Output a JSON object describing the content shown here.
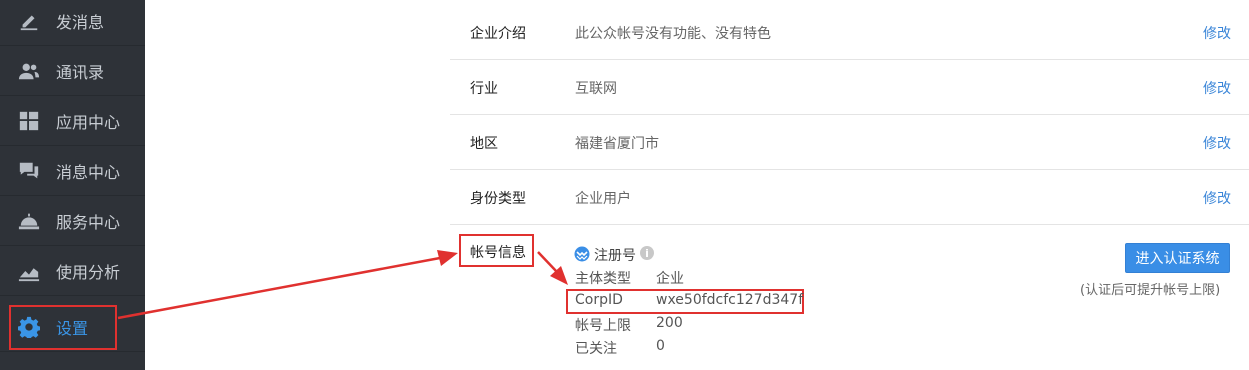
{
  "sidebar": {
    "items": [
      {
        "label": "发消息",
        "icon": "pencil-icon"
      },
      {
        "label": "通讯录",
        "icon": "contacts-icon"
      },
      {
        "label": "应用中心",
        "icon": "app-grid-icon"
      },
      {
        "label": "消息中心",
        "icon": "chat-bubbles-icon"
      },
      {
        "label": "服务中心",
        "icon": "service-bell-icon"
      },
      {
        "label": "使用分析",
        "icon": "line-chart-icon"
      },
      {
        "label": "设置",
        "icon": "gear-icon",
        "active": true
      }
    ]
  },
  "profile": {
    "rows": [
      {
        "label": "企业介绍",
        "value": "此公众帐号没有功能、没有特色",
        "action": "修改"
      },
      {
        "label": "行业",
        "value": "互联网",
        "action": "修改"
      },
      {
        "label": "地区",
        "value": "福建省厦门市",
        "action": "修改"
      },
      {
        "label": "身份类型",
        "value": "企业用户",
        "action": "修改"
      }
    ]
  },
  "account": {
    "label": "帐号信息",
    "register_title": "注册号",
    "fields": [
      {
        "key": "主体类型",
        "value": "企业"
      },
      {
        "key": "CorpID",
        "value": "wxe50fdcfc127d347f"
      },
      {
        "key": "帐号上限",
        "value": "200"
      },
      {
        "key": "已关注",
        "value": "0"
      }
    ],
    "verify_button": "进入认证系统",
    "verify_note": "(认证后可提升帐号上限)"
  },
  "colors": {
    "sidebar_bg": "#2e3238",
    "active": "#3a95e6",
    "link": "#3b86d8",
    "annotation": "#e0312f"
  }
}
